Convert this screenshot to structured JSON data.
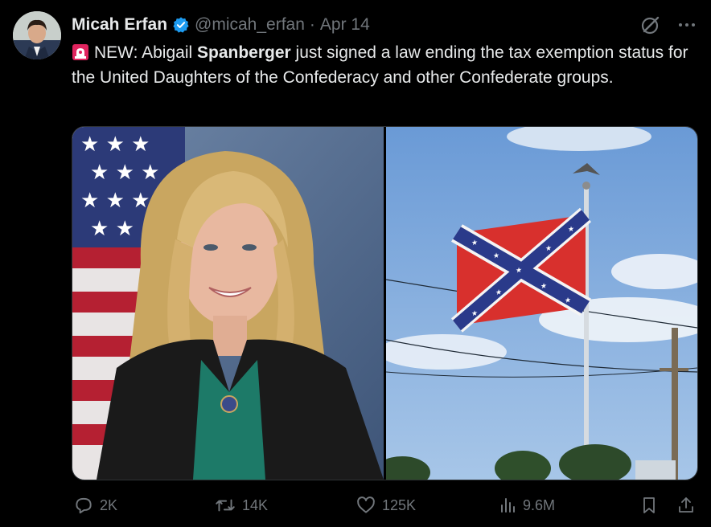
{
  "author": {
    "name": "Micah Erfan",
    "handle": "@micah_erfan",
    "separator": "·",
    "date": "Apr 14",
    "verified_color": "#1d9bf0"
  },
  "tweet": {
    "emoji": "rotating-light-icon",
    "text_part1": "NEW: Abigail ",
    "text_bold": "Spanberger",
    "text_part2": " just signed a law ending the tax exemption status for the United Daughters of the Confederacy and other Confederate groups."
  },
  "media": {
    "left_image": "portrait-photo",
    "right_image": "flag-photo"
  },
  "actions": {
    "reply_count": "2K",
    "retweet_count": "14K",
    "like_count": "125K",
    "views_count": "9.6M"
  },
  "colors": {
    "background": "#000000",
    "text": "#e7e9ea",
    "muted": "#71767b",
    "accent": "#1d9bf0"
  }
}
